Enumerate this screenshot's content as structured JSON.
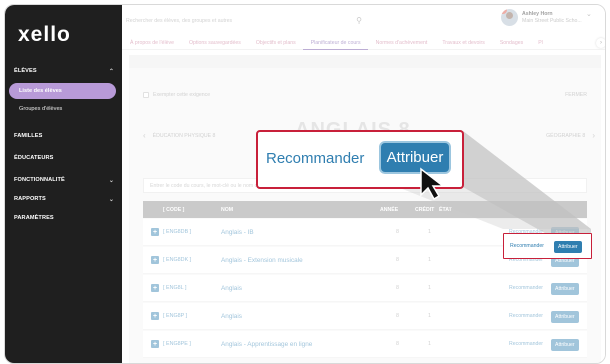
{
  "app": {
    "logo": "xello"
  },
  "sidebar": {
    "sections": [
      {
        "label": "ÉLÈVES",
        "chev": "^"
      },
      {
        "label": "FAMILLES"
      },
      {
        "label": "ÉDUCATEURS"
      },
      {
        "label": "FONCTIONNALITÉ",
        "chev": "v"
      },
      {
        "label": "RAPPORTS",
        "chev": "v"
      },
      {
        "label": "PARAMÈTRES"
      }
    ],
    "items": [
      {
        "label": "Liste des élèves"
      },
      {
        "label": "Groupes d'élèves"
      }
    ]
  },
  "search": {
    "placeholder": "Rechercher des élèves, des groupes et autres"
  },
  "user": {
    "name": "Ashley Horn",
    "school": "Main Street Public Scho...",
    "notifications": "3"
  },
  "tabs": [
    {
      "label": "À propos de l'élève"
    },
    {
      "label": "Options sauvegardées"
    },
    {
      "label": "Objectifs et plans"
    },
    {
      "label": "Planificateur de cours"
    },
    {
      "label": "Normes d'achèvement"
    },
    {
      "label": "Travaux et devoirs"
    },
    {
      "label": "Sondages"
    },
    {
      "label": "Pl"
    }
  ],
  "panel": {
    "exempt_label": "Exempter cette exigence",
    "close_label": "FERMER",
    "prev_course": "ÉDUCATION PHYSIQUE 8",
    "title": "ANGLAIS 8",
    "next_course": "GÉOGRAPHIE 8",
    "code_placeholder": "Entrer le code du cours, le mot-clé ou le nom du cours..."
  },
  "table": {
    "headers": {
      "code": "[ CODE ]",
      "name": "NOM",
      "year": "ANNÉE",
      "credit": "CRÉDIT",
      "state": "ÉTAT"
    },
    "rows": [
      {
        "code": "[ ENG8DB ]",
        "name": "Anglais - IB",
        "year": "8",
        "credit": "1",
        "recommend": "Recommander",
        "assign": "Attribuer"
      },
      {
        "code": "[ ENG8DK ]",
        "name": "Anglais - Extension musicale",
        "year": "8",
        "credit": "1",
        "recommend": "Recommander",
        "assign": "Attribuer"
      },
      {
        "code": "[ ENG8L ]",
        "name": "Anglais",
        "year": "8",
        "credit": "1",
        "recommend": "Recommander",
        "assign": "Attribuer"
      },
      {
        "code": "[ ENG8P ]",
        "name": "Anglais",
        "year": "8",
        "credit": "1",
        "recommend": "Recommander",
        "assign": "Attribuer"
      },
      {
        "code": "[ ENG8PE ]",
        "name": "Anglais - Apprentissage en ligne",
        "year": "8",
        "credit": "1",
        "recommend": "Recommander",
        "assign": "Attribuer"
      }
    ]
  },
  "callout": {
    "recommend": "Recommander",
    "assign": "Attribuer"
  },
  "colors": {
    "sidebar": "#1f1f1f",
    "active_nav": "#b89ad8",
    "link_blue": "#2f7eb0",
    "highlight_red": "#c8203a",
    "tab_pink": "#c06a8a",
    "tab_active": "#6a4aa0"
  },
  "icons": [
    "search-icon",
    "chevron-down-icon",
    "chevron-up-icon",
    "chevron-left-icon",
    "chevron-right-icon",
    "plus-icon",
    "cursor-arrow-icon"
  ]
}
